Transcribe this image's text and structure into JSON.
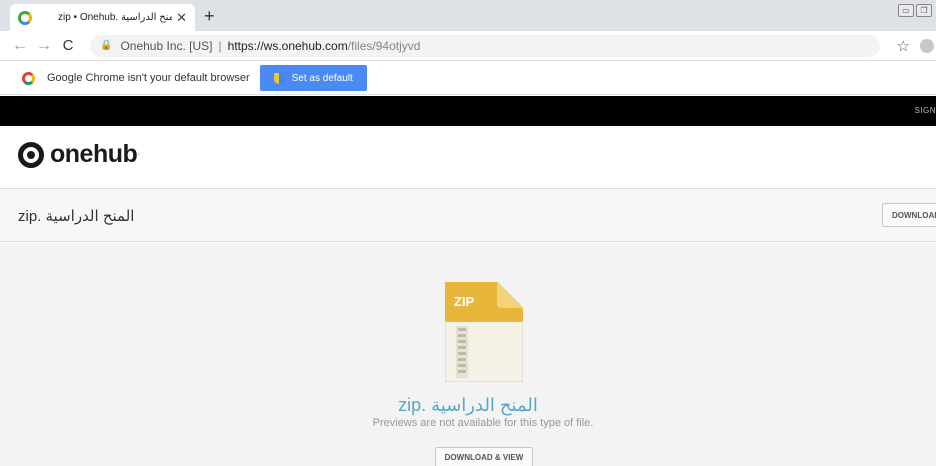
{
  "browser": {
    "tab_title": "zip • Onehub. المنح الدراسية",
    "tab_close": "✕",
    "new_tab": "+",
    "window_controls": [
      "▭",
      "❐"
    ],
    "nav": {
      "back": "←",
      "forward": "→",
      "reload": "C"
    },
    "address": {
      "lock": "🔒",
      "org": "Onehub Inc. [US]",
      "separator": "|",
      "host": "https://ws.onehub.com",
      "path": "/files/94otjyvd"
    },
    "star": "☆"
  },
  "infobar": {
    "message": "Google Chrome isn't your default browser",
    "button_label": "Set as default"
  },
  "site": {
    "sign_label": "SIGN",
    "logo_text": "onehub",
    "logo_tm": "·"
  },
  "file": {
    "name": "zip. المنح الدراسية",
    "download_label": "DOWNLOAD",
    "icon_label": "ZIP",
    "preview_name": "zip. المنح الدراسية",
    "preview_note": "Previews are not available for this type of file.",
    "download_view_label": "DOWNLOAD & VIEW"
  },
  "colors": {
    "accent": "#4a8af4",
    "zip_yellow": "#e8b63a",
    "link_blue": "#5aa6c8"
  }
}
